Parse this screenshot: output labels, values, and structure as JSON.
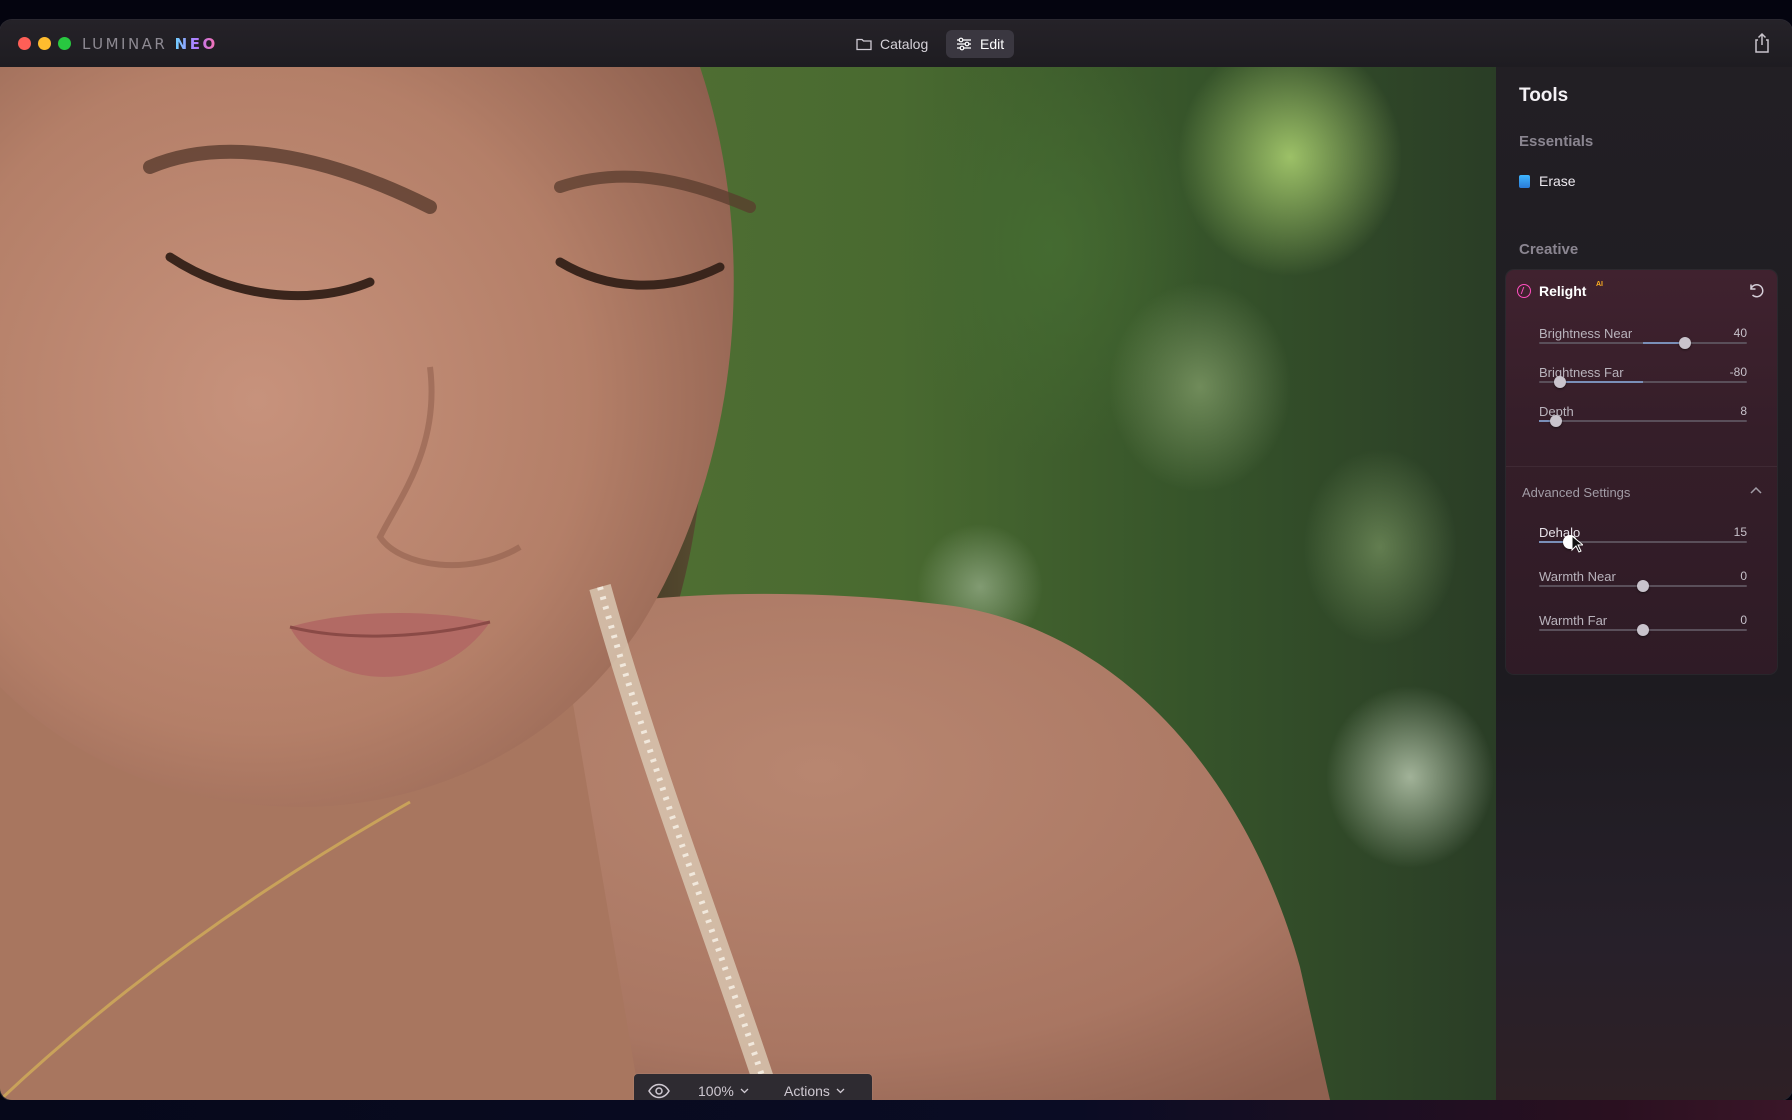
{
  "app": {
    "logo_main": "LUMINAR",
    "logo_accent": "NEO"
  },
  "nav": {
    "catalog_label": "Catalog",
    "edit_label": "Edit"
  },
  "tools": {
    "title": "Tools",
    "essentials_label": "Essentials",
    "erase_label": "Erase",
    "creative_label": "Creative",
    "relight": {
      "title": "Relight",
      "ai_badge": "AI",
      "sliders": [
        {
          "label": "Brightness Near",
          "value": "40",
          "min": -100,
          "max": 100,
          "num": 40
        },
        {
          "label": "Brightness Far",
          "value": "-80",
          "min": -100,
          "max": 100,
          "num": -80
        },
        {
          "label": "Depth",
          "value": "8",
          "min": 0,
          "max": 100,
          "num": 8
        }
      ],
      "advanced_label": "Advanced Settings",
      "advanced_sliders": [
        {
          "label": "Dehalo",
          "value": "15",
          "min": 0,
          "max": 100,
          "num": 15
        },
        {
          "label": "Warmth Near",
          "value": "0",
          "min": -100,
          "max": 100,
          "num": 0
        },
        {
          "label": "Warmth Far",
          "value": "0",
          "min": -100,
          "max": 100,
          "num": 0
        }
      ]
    }
  },
  "bottom_bar": {
    "zoom_label": "100%",
    "actions_label": "Actions"
  },
  "colors": {
    "accent_relight": "#ff4fbf",
    "ai_badge": "#ffb020",
    "slider_fill": "#7a8fb8"
  },
  "icons": [
    "eye-icon",
    "folder-icon",
    "sliders-icon",
    "share-icon",
    "reset-icon",
    "chevron-up-icon",
    "relight-icon",
    "erase-icon"
  ]
}
